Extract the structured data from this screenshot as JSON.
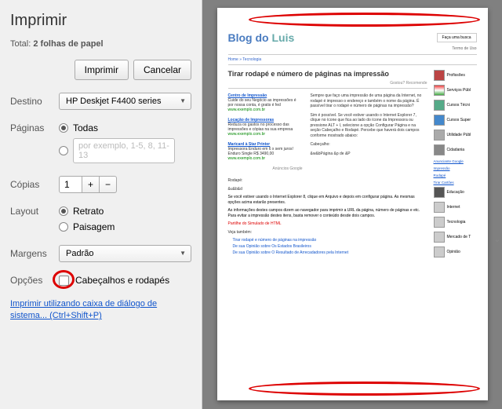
{
  "sidebar": {
    "title": "Imprimir",
    "total_prefix": "Total: ",
    "total_value": "2 folhas de papel",
    "print_btn": "Imprimir",
    "cancel_btn": "Cancelar",
    "dest_label": "Destino",
    "dest_value": "HP Deskjet F4400 series",
    "pages_label": "Páginas",
    "pages_all": "Todas",
    "pages_range_placeholder": "por exemplo, 1-5, 8, 11-13",
    "copies_label": "Cópias",
    "copies_value": "1",
    "layout_label": "Layout",
    "layout_portrait": "Retrato",
    "layout_landscape": "Paisagem",
    "margins_label": "Margens",
    "margins_value": "Padrão",
    "options_label": "Opções",
    "options_headers": "Cabeçalhos e rodapés",
    "syslink": "Imprimir utilizando caixa de diálogo de sistema... (Ctrl+Shift+P)"
  },
  "preview": {
    "blog_title_a": "Blog do",
    "blog_title_b": "Luis",
    "search_placeholder": "Faça uma busca",
    "terms": "Termo de Uso",
    "crumb": "Home » Tecnologia",
    "article_title": "Tirar rodapé e número de páginas na impressão",
    "recommend": "Gostou? Recomende",
    "links": [
      {
        "t": "Centro de Impressão",
        "s": "Cuide do seu Negócio as impressões é por nossa conta, é gratis é fed",
        "u": "www.exemplo.com.br"
      },
      {
        "t": "Locação de Impressoras",
        "s": "Reduza os gastos no processo das impressões e cópias na sua empresa",
        "u": "www.exemplo.com.br"
      },
      {
        "t": "Maricard à Star Printer",
        "s": "Impressora Enduro em 6 x sem juros! Enduro Single R$ 3490,00",
        "u": "www.exemplo.com.br"
      }
    ],
    "rt_para1": "Sempre que faço uma impressão de uma página da Internet, no rodapé é impresso o endereço e também o nome da página. É passível tirar o rodapé e número de páginas na impressão?",
    "rt_para2": "Sim é possível. Se você estiver usando o Internet Explorer 7, clique no ícone que fica ao lado do ícone da Impressora ou pressione ALT + I, selecione a opção Configurar Página e na seção Cabeçalho e Rodapé. Percebe que haverá dois campos conforme mostrado abaixo:",
    "lbl_cab": "Cabeçalho:",
    "val_cab": "&w&bPágina &p de &P",
    "google_ads": "Anúncios Google",
    "lbl_rod": "Rodapé:",
    "val_rod": "&u&b&d",
    "para3": "Se você estiver usando o Internet Explorer 8, clique em Arquivo e depois em configurar página. As mesmas opções acima estarão presentes.",
    "para4": "As informações destes campos dizem ao navegador para imprimir a URL da página, número de páginas e etc. Para evitar a impressão destes itens, basta remover o conteúdo desde dois campos.",
    "simulate": "Partilhe do Simulado de HTML",
    "veja": "Veja também:",
    "sublinks": [
      "Tirar rodapé e número de páginas na impressão",
      "De sua Opinião sobre Os Estados Brasileiros",
      "De sua Opinião sobre O Resultado de Arrecadadores pela Internet"
    ],
    "sidecol": [
      "Profissões",
      "Serviços Públ",
      "Cursos Técni",
      "Cursos Super",
      "Utilidade Públ",
      "Cidadania",
      "Educação",
      "Internet",
      "Tecnologia",
      "Mercado de T",
      "Opinião"
    ],
    "sc_minis": [
      "Anunciante Google",
      "Impressão",
      "Rodapé",
      "Tirar Cartões"
    ]
  }
}
